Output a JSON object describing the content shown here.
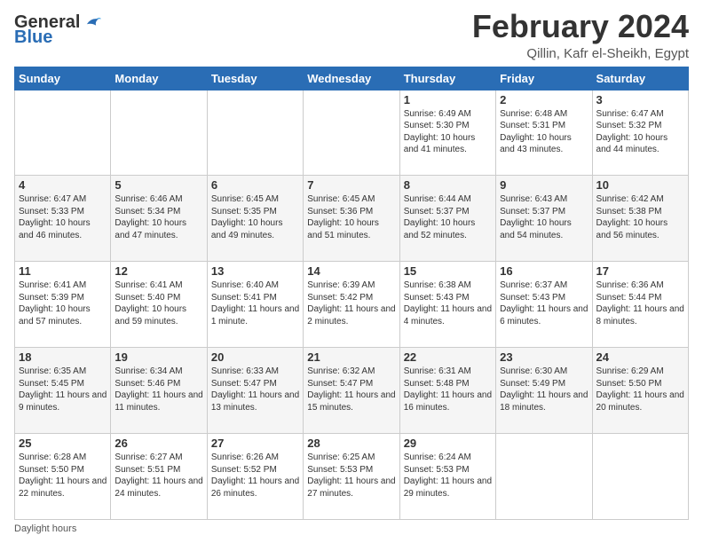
{
  "header": {
    "logo_general": "General",
    "logo_blue": "Blue",
    "month_title": "February 2024",
    "location": "Qillin, Kafr el-Sheikh, Egypt"
  },
  "days_of_week": [
    "Sunday",
    "Monday",
    "Tuesday",
    "Wednesday",
    "Thursday",
    "Friday",
    "Saturday"
  ],
  "footer": {
    "daylight_label": "Daylight hours"
  },
  "weeks": [
    [
      {
        "day": "",
        "info": ""
      },
      {
        "day": "",
        "info": ""
      },
      {
        "day": "",
        "info": ""
      },
      {
        "day": "",
        "info": ""
      },
      {
        "day": "1",
        "info": "Sunrise: 6:49 AM\nSunset: 5:30 PM\nDaylight: 10 hours\nand 41 minutes."
      },
      {
        "day": "2",
        "info": "Sunrise: 6:48 AM\nSunset: 5:31 PM\nDaylight: 10 hours\nand 43 minutes."
      },
      {
        "day": "3",
        "info": "Sunrise: 6:47 AM\nSunset: 5:32 PM\nDaylight: 10 hours\nand 44 minutes."
      }
    ],
    [
      {
        "day": "4",
        "info": "Sunrise: 6:47 AM\nSunset: 5:33 PM\nDaylight: 10 hours\nand 46 minutes."
      },
      {
        "day": "5",
        "info": "Sunrise: 6:46 AM\nSunset: 5:34 PM\nDaylight: 10 hours\nand 47 minutes."
      },
      {
        "day": "6",
        "info": "Sunrise: 6:45 AM\nSunset: 5:35 PM\nDaylight: 10 hours\nand 49 minutes."
      },
      {
        "day": "7",
        "info": "Sunrise: 6:45 AM\nSunset: 5:36 PM\nDaylight: 10 hours\nand 51 minutes."
      },
      {
        "day": "8",
        "info": "Sunrise: 6:44 AM\nSunset: 5:37 PM\nDaylight: 10 hours\nand 52 minutes."
      },
      {
        "day": "9",
        "info": "Sunrise: 6:43 AM\nSunset: 5:37 PM\nDaylight: 10 hours\nand 54 minutes."
      },
      {
        "day": "10",
        "info": "Sunrise: 6:42 AM\nSunset: 5:38 PM\nDaylight: 10 hours\nand 56 minutes."
      }
    ],
    [
      {
        "day": "11",
        "info": "Sunrise: 6:41 AM\nSunset: 5:39 PM\nDaylight: 10 hours\nand 57 minutes."
      },
      {
        "day": "12",
        "info": "Sunrise: 6:41 AM\nSunset: 5:40 PM\nDaylight: 10 hours\nand 59 minutes."
      },
      {
        "day": "13",
        "info": "Sunrise: 6:40 AM\nSunset: 5:41 PM\nDaylight: 11 hours\nand 1 minute."
      },
      {
        "day": "14",
        "info": "Sunrise: 6:39 AM\nSunset: 5:42 PM\nDaylight: 11 hours\nand 2 minutes."
      },
      {
        "day": "15",
        "info": "Sunrise: 6:38 AM\nSunset: 5:43 PM\nDaylight: 11 hours\nand 4 minutes."
      },
      {
        "day": "16",
        "info": "Sunrise: 6:37 AM\nSunset: 5:43 PM\nDaylight: 11 hours\nand 6 minutes."
      },
      {
        "day": "17",
        "info": "Sunrise: 6:36 AM\nSunset: 5:44 PM\nDaylight: 11 hours\nand 8 minutes."
      }
    ],
    [
      {
        "day": "18",
        "info": "Sunrise: 6:35 AM\nSunset: 5:45 PM\nDaylight: 11 hours\nand 9 minutes."
      },
      {
        "day": "19",
        "info": "Sunrise: 6:34 AM\nSunset: 5:46 PM\nDaylight: 11 hours\nand 11 minutes."
      },
      {
        "day": "20",
        "info": "Sunrise: 6:33 AM\nSunset: 5:47 PM\nDaylight: 11 hours\nand 13 minutes."
      },
      {
        "day": "21",
        "info": "Sunrise: 6:32 AM\nSunset: 5:47 PM\nDaylight: 11 hours\nand 15 minutes."
      },
      {
        "day": "22",
        "info": "Sunrise: 6:31 AM\nSunset: 5:48 PM\nDaylight: 11 hours\nand 16 minutes."
      },
      {
        "day": "23",
        "info": "Sunrise: 6:30 AM\nSunset: 5:49 PM\nDaylight: 11 hours\nand 18 minutes."
      },
      {
        "day": "24",
        "info": "Sunrise: 6:29 AM\nSunset: 5:50 PM\nDaylight: 11 hours\nand 20 minutes."
      }
    ],
    [
      {
        "day": "25",
        "info": "Sunrise: 6:28 AM\nSunset: 5:50 PM\nDaylight: 11 hours\nand 22 minutes."
      },
      {
        "day": "26",
        "info": "Sunrise: 6:27 AM\nSunset: 5:51 PM\nDaylight: 11 hours\nand 24 minutes."
      },
      {
        "day": "27",
        "info": "Sunrise: 6:26 AM\nSunset: 5:52 PM\nDaylight: 11 hours\nand 26 minutes."
      },
      {
        "day": "28",
        "info": "Sunrise: 6:25 AM\nSunset: 5:53 PM\nDaylight: 11 hours\nand 27 minutes."
      },
      {
        "day": "29",
        "info": "Sunrise: 6:24 AM\nSunset: 5:53 PM\nDaylight: 11 hours\nand 29 minutes."
      },
      {
        "day": "",
        "info": ""
      },
      {
        "day": "",
        "info": ""
      }
    ]
  ]
}
